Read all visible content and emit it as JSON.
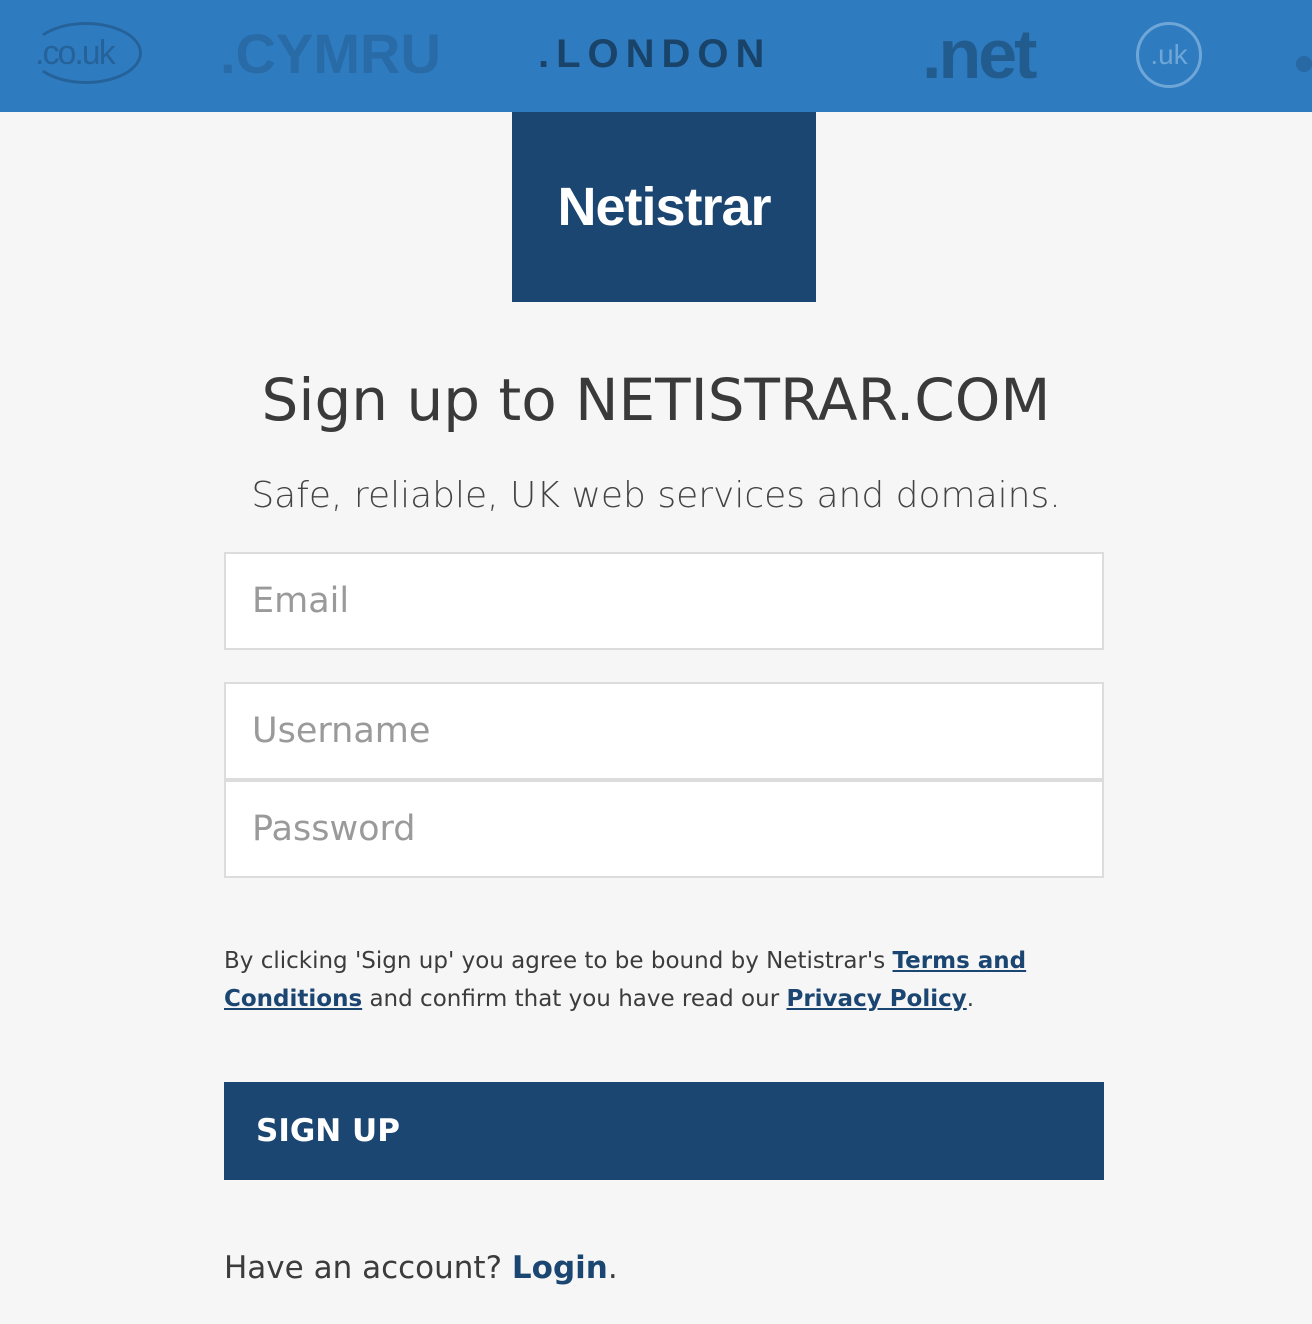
{
  "banner": {
    "tlds": [
      ".co.uk",
      ".CYMRU",
      ".LONDON",
      ".net",
      ".uk"
    ]
  },
  "logo": {
    "text": "Netistrar"
  },
  "heading": "Sign up to NETISTRAR.COM",
  "subheading": "Safe, reliable, UK web services and domains.",
  "form": {
    "email_placeholder": "Email",
    "username_placeholder": "Username",
    "password_placeholder": "Password",
    "email_value": "",
    "username_value": "",
    "password_value": ""
  },
  "legal": {
    "prefix": "By clicking 'Sign up' you agree to be bound by Netistrar's ",
    "terms_link": "Terms and Conditions",
    "middle": " and confirm that you have read our ",
    "privacy_link": "Privacy Policy",
    "suffix": "."
  },
  "signup_button": "SIGN UP",
  "login": {
    "prompt": "Have an account? ",
    "link": "Login",
    "suffix": "."
  },
  "colors": {
    "banner": "#2f7bbf",
    "brand": "#1b4672",
    "background": "#f6f6f6"
  }
}
